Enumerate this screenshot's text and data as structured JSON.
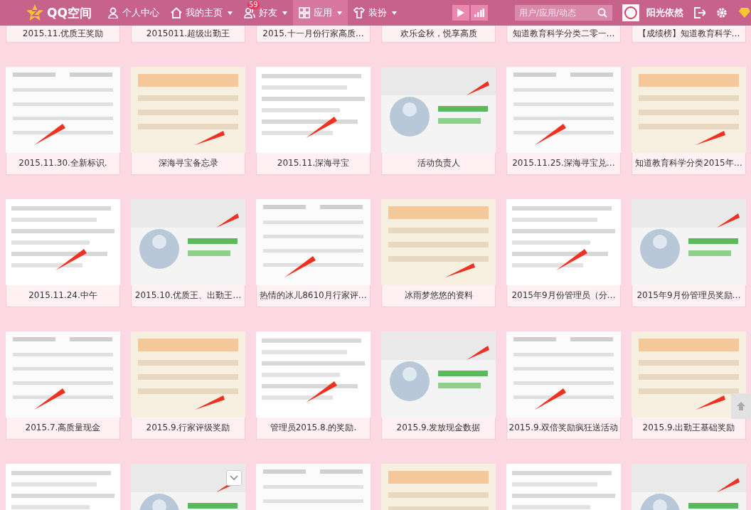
{
  "header": {
    "logo": "QQ空间",
    "nav": [
      {
        "kind": "person",
        "label": "个人中心",
        "caret": false,
        "selected": false
      },
      {
        "kind": "home",
        "label": "我的主页",
        "caret": true,
        "selected": false
      },
      {
        "kind": "friends",
        "label": "好友",
        "caret": true,
        "selected": false,
        "badge": "59"
      },
      {
        "kind": "apps",
        "label": "应用",
        "caret": true,
        "selected": true
      },
      {
        "kind": "shirt",
        "label": "装扮",
        "caret": true,
        "selected": false
      }
    ],
    "search": {
      "placeholder": "用户/应用/动态"
    },
    "user": {
      "name": "阳光依然"
    }
  },
  "albums": [
    {
      "cards": [
        {
          "caption": "2015.11.优质王奖励"
        },
        {
          "caption": "2015011.超级出勤王"
        },
        {
          "caption": "2015.十一月份行家高质…"
        },
        {
          "caption": "欢乐金秋，悦享高质"
        },
        {
          "caption": "知道教育科学分类二零一…"
        },
        {
          "caption": "【成绩榜】知道教育科学…"
        }
      ]
    },
    {
      "cards": [
        {
          "caption": "2015.11.30.全新标识."
        },
        {
          "caption": "深海寻宝备忘录"
        },
        {
          "caption": "2015.11.深海寻宝"
        },
        {
          "caption": "活动负责人"
        },
        {
          "caption": "2015.11.25.深海寻宝兑…"
        },
        {
          "caption": "知道教育科学分类2015年…"
        }
      ]
    },
    {
      "cards": [
        {
          "caption": "2015.11.24.中午"
        },
        {
          "caption": "2015.10.优质王、出勤王…"
        },
        {
          "caption": "热情的冰儿8610月行家评…"
        },
        {
          "caption": "冰雨梦悠悠的资料"
        },
        {
          "caption": "2015年9月份管理员（分…"
        },
        {
          "caption": "2015年9月份管理员奖励…"
        }
      ]
    },
    {
      "cards": [
        {
          "caption": "2015.7.高质量现金"
        },
        {
          "caption": "2015.9.行家评级奖励"
        },
        {
          "caption": "管理员2015.8.的奖励."
        },
        {
          "caption": "2015.9.发放现金数据"
        },
        {
          "caption": "2015.9.双倍奖励疯狂送活动"
        },
        {
          "caption": "2015.9.出勤王基础奖励"
        }
      ]
    },
    {
      "cards": [
        {
          "kind": "picture"
        },
        {
          "kind": "picture"
        },
        {
          "kind": "picture"
        },
        {
          "kind": "picture"
        },
        {
          "kind": "picture"
        },
        {
          "kind": "picture"
        }
      ]
    }
  ]
}
